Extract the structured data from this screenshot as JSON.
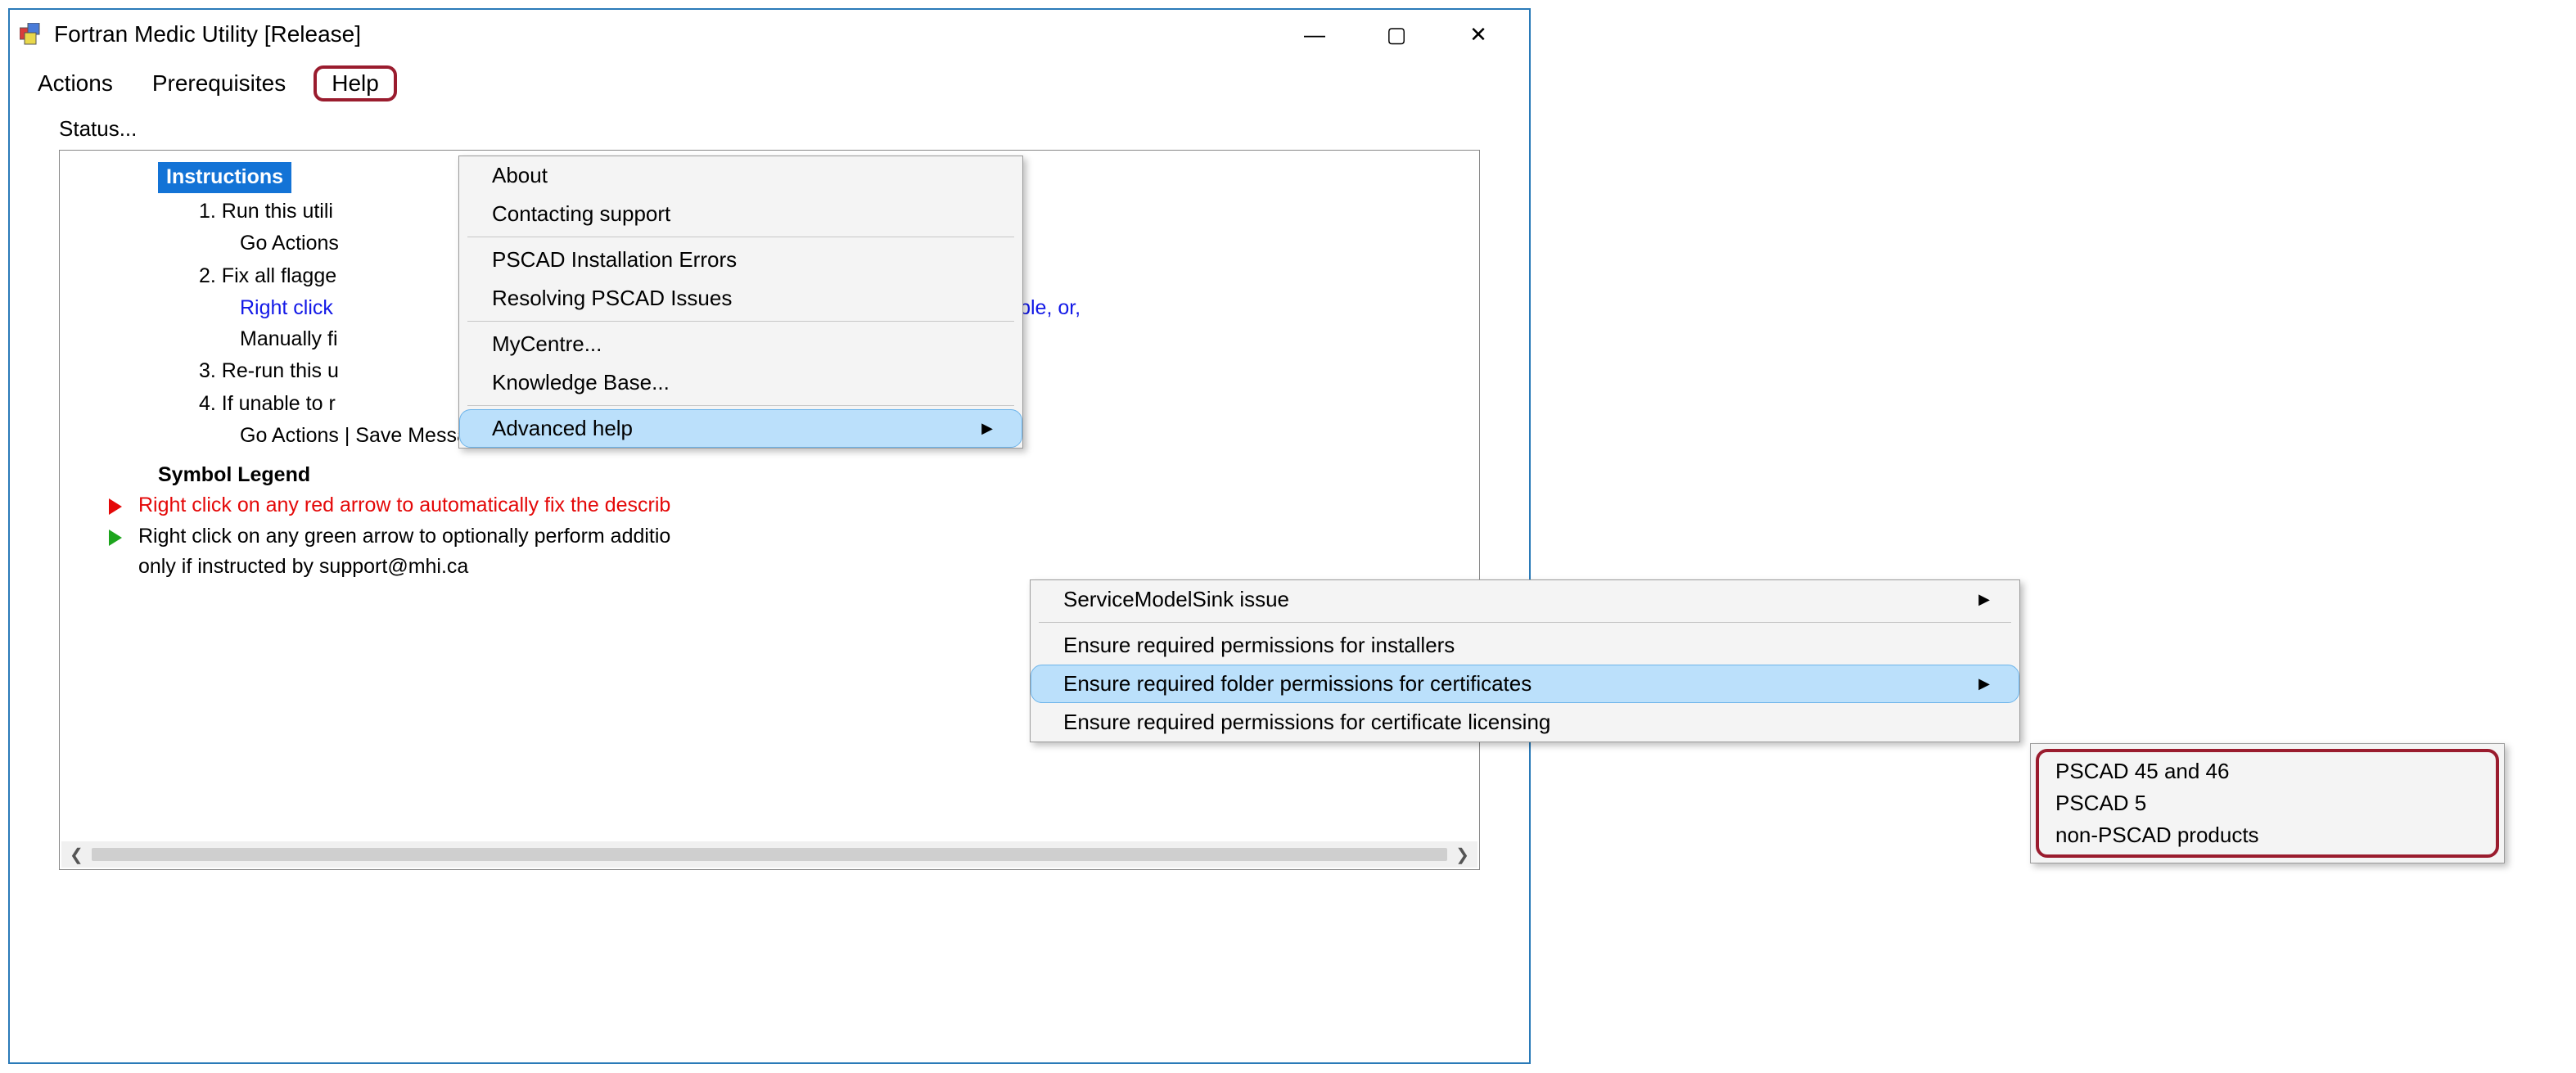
{
  "window": {
    "title": "Fortran Medic Utility [Release]",
    "controls": {
      "min": "—",
      "max": "▢",
      "close": "✕"
    }
  },
  "menubar": {
    "actions": "Actions",
    "prerequisites": "Prerequisites",
    "help": "Help"
  },
  "status_label": "Status...",
  "instructions": {
    "heading": "Instructions",
    "item1": "1. Run this utili",
    "item1_sub": "Go Actions",
    "item2": "2. Fix all flagge",
    "item2_sub_blue": "Right click",
    "item2_sub_blue_tail": "x the error, if possible, or,",
    "item2_sub2": "Manually fi",
    "item3": "3. Re-run this u",
    "item4": "4. If unable to r",
    "item4_sub": "Go Actions | Save Messages As..., and then e-mail the"
  },
  "legend": {
    "heading": "Symbol Legend",
    "red_row": "Right click on any red arrow to automatically fix the describ",
    "green_row": "Right click on any green arrow to optionally perform additio",
    "green_row2": "only if instructed by support@mhi.ca"
  },
  "help_menu": {
    "about": "About",
    "contact": "Contacting support",
    "pscad_install": "PSCAD Installation Errors",
    "pscad_resolve": "Resolving PSCAD Issues",
    "mycentre": "MyCentre...",
    "kb": "Knowledge Base...",
    "advanced": "Advanced help"
  },
  "advanced_menu": {
    "service_model": "ServiceModelSink issue",
    "perm_installers": "Ensure required permissions for installers",
    "perm_folder_certs": "Ensure required folder permissions for certificates",
    "perm_cert_licensing": "Ensure required permissions for certificate licensing"
  },
  "certs_menu": {
    "pscad4546": "PSCAD 45 and 46",
    "pscad5": "PSCAD 5",
    "nonpscad": "non-PSCAD products"
  },
  "scrollbar": {
    "left": "❮",
    "right": "❯"
  }
}
